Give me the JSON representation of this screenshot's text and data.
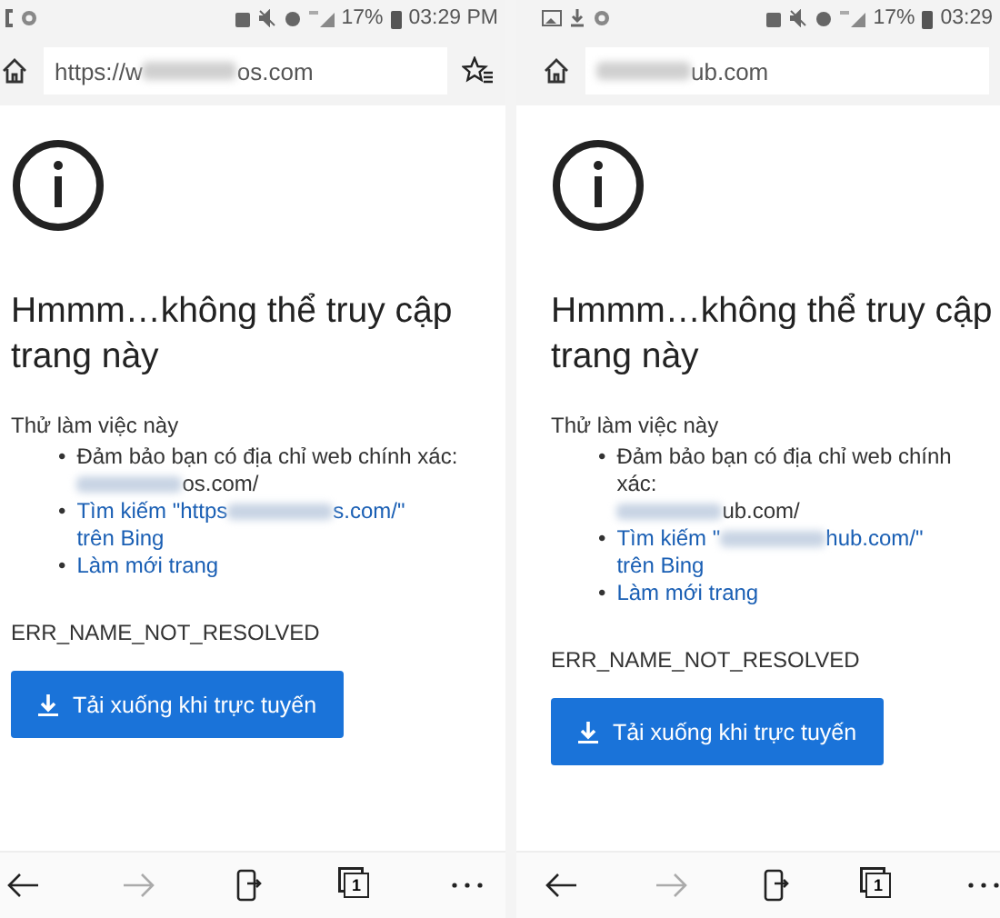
{
  "panels": [
    {
      "status_bar": {
        "notification_icons": [
          {
            "kind": "partial"
          },
          {
            "kind": "settings"
          }
        ],
        "battery": "17%",
        "time": "03:29 PM"
      },
      "address_bar": {
        "prefix": "https://w",
        "suffix": "os.com",
        "show_favorites": true
      },
      "heading": "Hmmm…không thể truy cập trang này",
      "intro": "Thử làm việc này",
      "suggestions": [
        {
          "marker": "•",
          "kind": "text",
          "text": "Đảm bảo bạn có địa chỉ web chính xác:",
          "url_suffix": "os.com/"
        },
        {
          "marker": "•",
          "kind": "link",
          "text": "Tìm kiếm \"https",
          "url_suffix": "s.com/\"",
          "after": "trên Bing"
        },
        {
          "marker": "•",
          "kind": "link",
          "text": "Làm mới trang"
        }
      ],
      "error_code": "ERR_NAME_NOT_RESOLVED",
      "download_button": "Tải xuống khi trực tuyến",
      "tab_count": "1"
    },
    {
      "status_bar": {
        "notification_icons": [
          {
            "kind": "image"
          },
          {
            "kind": "download"
          },
          {
            "kind": "settings"
          }
        ],
        "battery": "17%",
        "time": "03:29"
      },
      "address_bar": {
        "suffix": "ub.com",
        "show_favorites": false
      },
      "heading": "Hmmm…không thể truy cập trang này",
      "intro": "Thử làm việc này",
      "suggestions": [
        {
          "marker": "•",
          "kind": "text",
          "text": "Đảm bảo bạn có địa chỉ web chính xác:",
          "url_suffix": "ub.com/"
        },
        {
          "marker": "•",
          "kind": "link",
          "text": "Tìm kiếm \"",
          "url_suffix": "hub.com/\"",
          "after": "trên Bing"
        },
        {
          "marker": "•",
          "kind": "link",
          "text": "Làm mới trang"
        }
      ],
      "error_code": "ERR_NAME_NOT_RESOLVED",
      "download_button": "Tải xuống khi trực tuyến",
      "tab_count": "1"
    }
  ]
}
